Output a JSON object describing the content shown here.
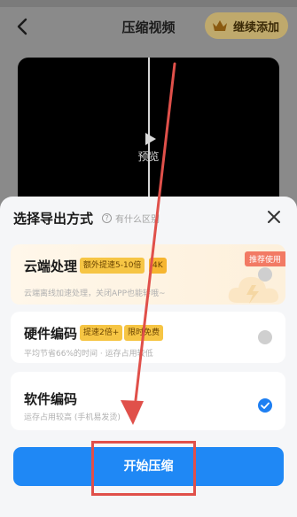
{
  "header": {
    "title": "压缩视频",
    "continue_label": "继续添加"
  },
  "video": {
    "preview_label": "预览"
  },
  "sheet": {
    "title": "选择导出方式",
    "hint": "有什么区别",
    "options": [
      {
        "name": "云端处理",
        "tags": [
          "额外提速5-10倍",
          "4K"
        ],
        "badge": "推荐使用",
        "desc": "云端离线加速处理，关闭APP也能转哦~",
        "selected": false
      },
      {
        "name": "硬件编码",
        "tags": [
          "提速2倍+",
          "限时免费"
        ],
        "desc": "平均节省66%的时间 · 运存占用较低",
        "selected": false
      },
      {
        "name": "软件编码",
        "tags": [],
        "desc": "运存占用较高 (手机易发烫)",
        "selected": true
      }
    ],
    "start_label": "开始压缩"
  },
  "colors": {
    "accent": "#1f88f5",
    "tag_yellow": "#f6c544",
    "badge_red": "#f27a64",
    "annotation": "#e0504a"
  }
}
